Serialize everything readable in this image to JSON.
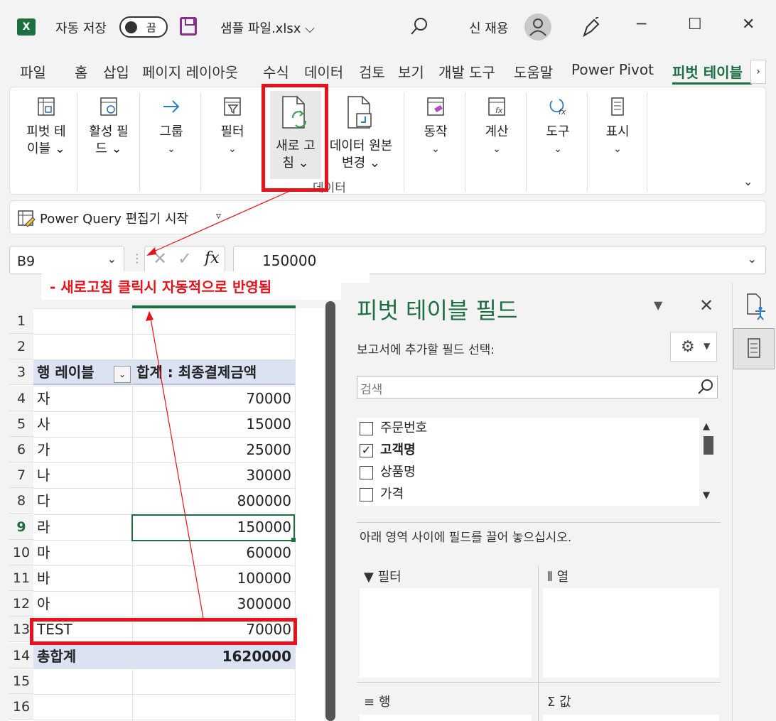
{
  "titlebar": {
    "app_icon": "X",
    "autosave_label": "자동 저장",
    "autosave_state": "끔",
    "filename": "샘플 파일.xlsx",
    "filename_dropdown": "⌵",
    "user_name": "신 재용",
    "minimize": "─",
    "maximize": "☐",
    "close": "✕"
  },
  "tabs": [
    "파일",
    "홈",
    "삽입",
    "페이지 레이아웃",
    "수식",
    "데이터",
    "검토",
    "보기",
    "개발 도구",
    "도움말",
    "Power Pivot",
    "피벗 테이블"
  ],
  "active_tab": "피벗 테이블",
  "ribbon": {
    "buttons": [
      {
        "l1": "피벗 테",
        "l2": "이블 ⌄"
      },
      {
        "l1": "활성 필",
        "l2": "드 ⌄"
      },
      {
        "l1": "그룹",
        "l2": "⌄"
      },
      {
        "l1": "필터",
        "l2": "⌄"
      },
      {
        "l1": "새로 고",
        "l2": "침 ⌄"
      },
      {
        "l1": "데이터 원본",
        "l2": "변경 ⌄"
      },
      {
        "l1": "동작",
        "l2": "⌄"
      },
      {
        "l1": "계산",
        "l2": "⌄"
      },
      {
        "l1": "도구",
        "l2": "⌄"
      },
      {
        "l1": "표시",
        "l2": "⌄"
      }
    ],
    "group_label": "데이터",
    "collapse": "⌄"
  },
  "powerquery": {
    "label": "Power Query 편집기 시작",
    "dropdown": "▿"
  },
  "formula_bar": {
    "name_box": "B9",
    "formula": "150000",
    "fx": "fx"
  },
  "annotation": "-   새로고침 클릭시 자동적으로 반영됨",
  "sheet": {
    "row_numbers": [
      "1",
      "2",
      "3",
      "4",
      "5",
      "6",
      "7",
      "8",
      "9",
      "10",
      "11",
      "12",
      "13",
      "14",
      "15",
      "16"
    ],
    "pivot_header": {
      "row_label": "행 레이블",
      "sum_label": "합계 : 최종결제금액"
    },
    "rows": [
      {
        "label": "자",
        "value": "70000"
      },
      {
        "label": "사",
        "value": "15000"
      },
      {
        "label": "가",
        "value": "25000"
      },
      {
        "label": "나",
        "value": "30000"
      },
      {
        "label": "다",
        "value": "800000"
      },
      {
        "label": "라",
        "value": "150000"
      },
      {
        "label": "마",
        "value": "60000"
      },
      {
        "label": "바",
        "value": "100000"
      },
      {
        "label": "아",
        "value": "300000"
      },
      {
        "label": "TEST",
        "value": "70000"
      }
    ],
    "total": {
      "label": "총합계",
      "value": "1620000"
    },
    "selected_cell": "B9"
  },
  "pivot_pane": {
    "title": "피벗 테이블 필드",
    "subtitle": "보고서에 추가할 필드 선택:",
    "search_placeholder": "검색",
    "fields": [
      {
        "name": "주문번호",
        "checked": false
      },
      {
        "name": "고객명",
        "checked": true
      },
      {
        "name": "상품명",
        "checked": false
      },
      {
        "name": "가격",
        "checked": false
      }
    ],
    "hint": "아래 영역 사이에 필드를 끌어 놓으십시오.",
    "areas": {
      "filter": "필터",
      "columns": "열",
      "rows": "행",
      "values": "값"
    }
  },
  "colors": {
    "accent": "#1d6f42",
    "highlight": "#e8121a",
    "pivot_header_bg": "#dbe2f2"
  }
}
